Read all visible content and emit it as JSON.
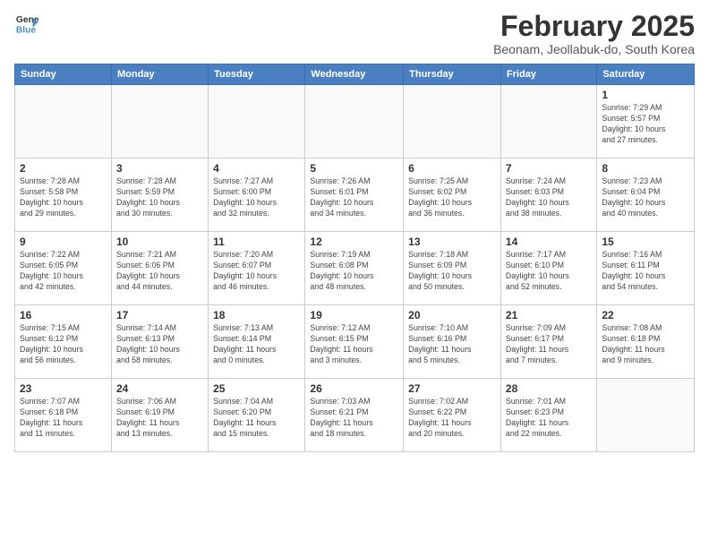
{
  "header": {
    "logo_line1": "General",
    "logo_line2": "Blue",
    "month_title": "February 2025",
    "location": "Beonam, Jeollabuk-do, South Korea"
  },
  "days_of_week": [
    "Sunday",
    "Monday",
    "Tuesday",
    "Wednesday",
    "Thursday",
    "Friday",
    "Saturday"
  ],
  "weeks": [
    [
      {
        "day": "",
        "info": ""
      },
      {
        "day": "",
        "info": ""
      },
      {
        "day": "",
        "info": ""
      },
      {
        "day": "",
        "info": ""
      },
      {
        "day": "",
        "info": ""
      },
      {
        "day": "",
        "info": ""
      },
      {
        "day": "1",
        "info": "Sunrise: 7:29 AM\nSunset: 5:57 PM\nDaylight: 10 hours\nand 27 minutes."
      }
    ],
    [
      {
        "day": "2",
        "info": "Sunrise: 7:28 AM\nSunset: 5:58 PM\nDaylight: 10 hours\nand 29 minutes."
      },
      {
        "day": "3",
        "info": "Sunrise: 7:28 AM\nSunset: 5:59 PM\nDaylight: 10 hours\nand 30 minutes."
      },
      {
        "day": "4",
        "info": "Sunrise: 7:27 AM\nSunset: 6:00 PM\nDaylight: 10 hours\nand 32 minutes."
      },
      {
        "day": "5",
        "info": "Sunrise: 7:26 AM\nSunset: 6:01 PM\nDaylight: 10 hours\nand 34 minutes."
      },
      {
        "day": "6",
        "info": "Sunrise: 7:25 AM\nSunset: 6:02 PM\nDaylight: 10 hours\nand 36 minutes."
      },
      {
        "day": "7",
        "info": "Sunrise: 7:24 AM\nSunset: 6:03 PM\nDaylight: 10 hours\nand 38 minutes."
      },
      {
        "day": "8",
        "info": "Sunrise: 7:23 AM\nSunset: 6:04 PM\nDaylight: 10 hours\nand 40 minutes."
      }
    ],
    [
      {
        "day": "9",
        "info": "Sunrise: 7:22 AM\nSunset: 6:05 PM\nDaylight: 10 hours\nand 42 minutes."
      },
      {
        "day": "10",
        "info": "Sunrise: 7:21 AM\nSunset: 6:06 PM\nDaylight: 10 hours\nand 44 minutes."
      },
      {
        "day": "11",
        "info": "Sunrise: 7:20 AM\nSunset: 6:07 PM\nDaylight: 10 hours\nand 46 minutes."
      },
      {
        "day": "12",
        "info": "Sunrise: 7:19 AM\nSunset: 6:08 PM\nDaylight: 10 hours\nand 48 minutes."
      },
      {
        "day": "13",
        "info": "Sunrise: 7:18 AM\nSunset: 6:09 PM\nDaylight: 10 hours\nand 50 minutes."
      },
      {
        "day": "14",
        "info": "Sunrise: 7:17 AM\nSunset: 6:10 PM\nDaylight: 10 hours\nand 52 minutes."
      },
      {
        "day": "15",
        "info": "Sunrise: 7:16 AM\nSunset: 6:11 PM\nDaylight: 10 hours\nand 54 minutes."
      }
    ],
    [
      {
        "day": "16",
        "info": "Sunrise: 7:15 AM\nSunset: 6:12 PM\nDaylight: 10 hours\nand 56 minutes."
      },
      {
        "day": "17",
        "info": "Sunrise: 7:14 AM\nSunset: 6:13 PM\nDaylight: 10 hours\nand 58 minutes."
      },
      {
        "day": "18",
        "info": "Sunrise: 7:13 AM\nSunset: 6:14 PM\nDaylight: 11 hours\nand 0 minutes."
      },
      {
        "day": "19",
        "info": "Sunrise: 7:12 AM\nSunset: 6:15 PM\nDaylight: 11 hours\nand 3 minutes."
      },
      {
        "day": "20",
        "info": "Sunrise: 7:10 AM\nSunset: 6:16 PM\nDaylight: 11 hours\nand 5 minutes."
      },
      {
        "day": "21",
        "info": "Sunrise: 7:09 AM\nSunset: 6:17 PM\nDaylight: 11 hours\nand 7 minutes."
      },
      {
        "day": "22",
        "info": "Sunrise: 7:08 AM\nSunset: 6:18 PM\nDaylight: 11 hours\nand 9 minutes."
      }
    ],
    [
      {
        "day": "23",
        "info": "Sunrise: 7:07 AM\nSunset: 6:18 PM\nDaylight: 11 hours\nand 11 minutes."
      },
      {
        "day": "24",
        "info": "Sunrise: 7:06 AM\nSunset: 6:19 PM\nDaylight: 11 hours\nand 13 minutes."
      },
      {
        "day": "25",
        "info": "Sunrise: 7:04 AM\nSunset: 6:20 PM\nDaylight: 11 hours\nand 15 minutes."
      },
      {
        "day": "26",
        "info": "Sunrise: 7:03 AM\nSunset: 6:21 PM\nDaylight: 11 hours\nand 18 minutes."
      },
      {
        "day": "27",
        "info": "Sunrise: 7:02 AM\nSunset: 6:22 PM\nDaylight: 11 hours\nand 20 minutes."
      },
      {
        "day": "28",
        "info": "Sunrise: 7:01 AM\nSunset: 6:23 PM\nDaylight: 11 hours\nand 22 minutes."
      },
      {
        "day": "",
        "info": ""
      }
    ]
  ]
}
